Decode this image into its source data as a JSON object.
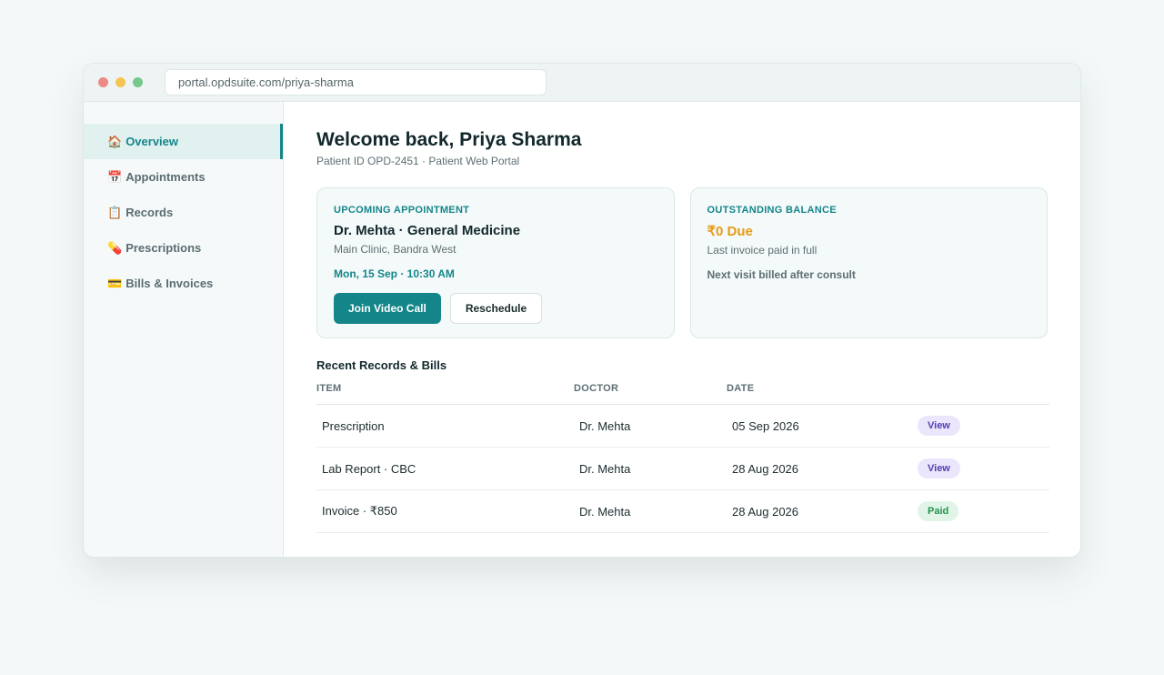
{
  "browser": {
    "url": "portal.opdsuite.com/priya-sharma"
  },
  "sidebar": {
    "items": [
      {
        "icon": "🏠",
        "label": "Overview",
        "active": true
      },
      {
        "icon": "📅",
        "label": "Appointments",
        "active": false
      },
      {
        "icon": "📋",
        "label": "Records",
        "active": false
      },
      {
        "icon": "💊",
        "label": "Prescriptions",
        "active": false
      },
      {
        "icon": "💳",
        "label": "Bills & Invoices",
        "active": false
      }
    ]
  },
  "header": {
    "title": "Welcome back, Priya Sharma",
    "subtitle": "Patient ID OPD-2451 · Patient Web Portal"
  },
  "appointment": {
    "label": "UPCOMING APPOINTMENT",
    "doctor": "Dr. Mehta · General Medicine",
    "location": "Main Clinic, Bandra West",
    "time": "Mon, 15 Sep · 10:30 AM",
    "join_label": "Join Video Call",
    "reschedule_label": "Reschedule"
  },
  "balance": {
    "label": "OUTSTANDING BALANCE",
    "amount": "₹0 Due",
    "amount_color": "#e89a16",
    "last_invoice": "Last invoice paid in full",
    "note": "Next visit billed after consult"
  },
  "records": {
    "title": "Recent Records & Bills",
    "columns": [
      "ITEM",
      "DOCTOR",
      "DATE"
    ],
    "rows": [
      {
        "item": "Prescription",
        "doctor": "Dr. Mehta",
        "date": "05 Sep 2026",
        "action": "View",
        "action_type": "view"
      },
      {
        "item": "Lab Report · CBC",
        "doctor": "Dr. Mehta",
        "date": "28 Aug 2026",
        "action": "View",
        "action_type": "view"
      },
      {
        "item": "Invoice · ₹850",
        "doctor": "Dr. Mehta",
        "date": "28 Aug 2026",
        "action": "Paid",
        "action_type": "paid"
      }
    ]
  },
  "colors": {
    "accent": "#14868a",
    "view_badge": "#5340b4",
    "paid_badge": "#24924a"
  }
}
